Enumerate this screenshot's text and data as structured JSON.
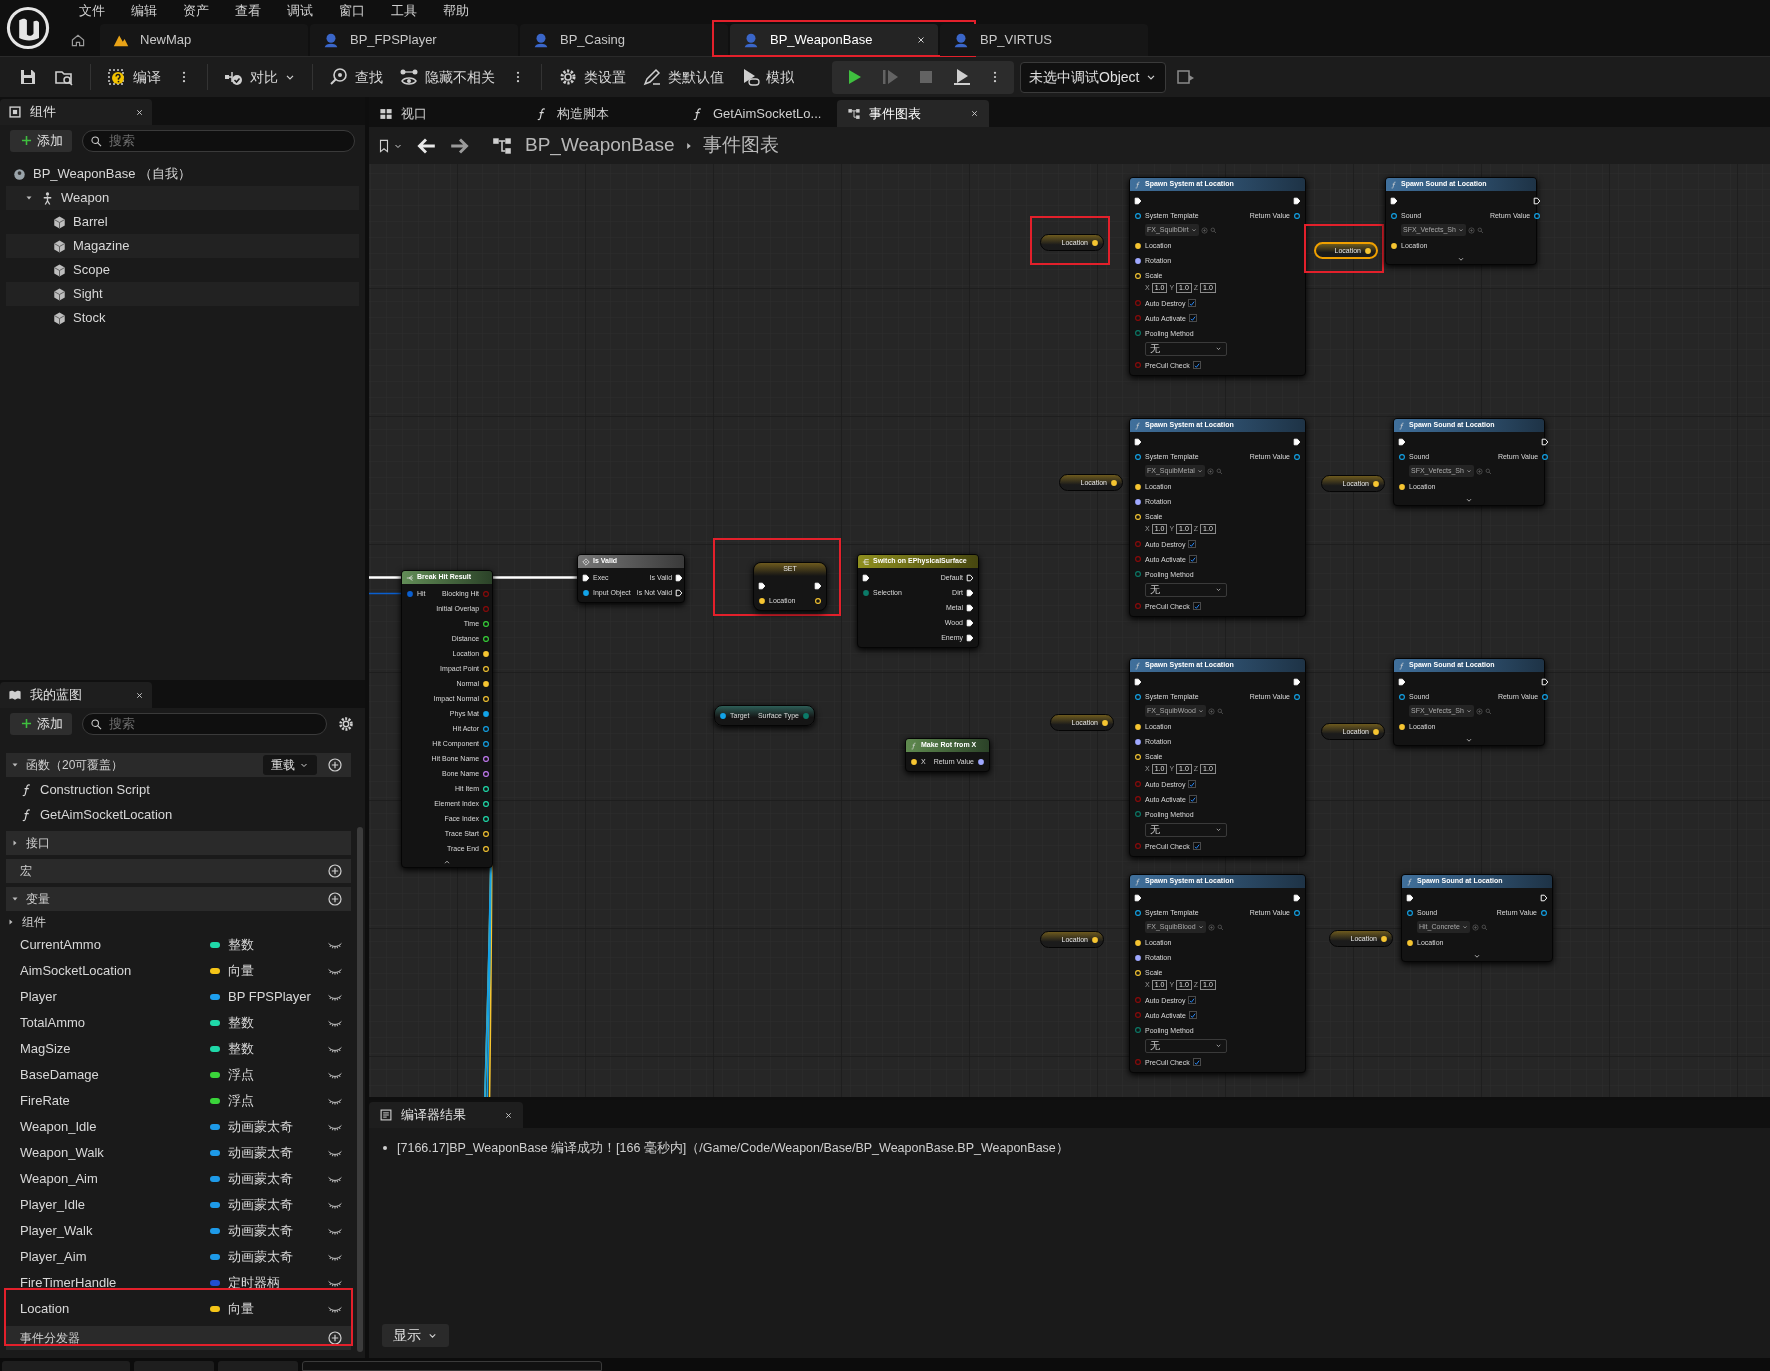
{
  "menu": [
    "文件",
    "编辑",
    "资产",
    "查看",
    "调试",
    "窗口",
    "工具",
    "帮助"
  ],
  "document_tabs": [
    {
      "label": "NewMap",
      "kind": "level",
      "selected": false
    },
    {
      "label": "BP_FPSPlayer",
      "kind": "blueprint",
      "selected": false
    },
    {
      "label": "BP_Casing",
      "kind": "blueprint",
      "selected": false
    },
    {
      "label": "BP_WeaponBase",
      "kind": "blueprint",
      "selected": true,
      "annotated": true
    },
    {
      "label": "BP_VIRTUS",
      "kind": "blueprint",
      "selected": false
    }
  ],
  "toolbar": [
    [
      {
        "kind": "save"
      },
      {
        "kind": "browse"
      }
    ],
    [
      {
        "kind": "compile",
        "label": "编译"
      },
      {
        "kind": "more"
      }
    ],
    [
      {
        "kind": "diff",
        "label": "对比",
        "menu": true
      }
    ],
    [
      {
        "kind": "find",
        "label": "查找"
      },
      {
        "kind": "hide",
        "label": "隐藏不相关"
      },
      {
        "kind": "more"
      }
    ],
    [
      {
        "kind": "settings",
        "label": "类设置"
      },
      {
        "kind": "defaults",
        "label": "类默认值"
      },
      {
        "kind": "simulate",
        "label": "模拟"
      }
    ],
    [
      {
        "kind": "play",
        "disabled": false
      },
      {
        "kind": "step",
        "disabled": true
      },
      {
        "kind": "stop",
        "disabled": true
      },
      {
        "kind": "eject",
        "disabled": false
      },
      {
        "kind": "more",
        "disabled": false
      }
    ],
    [
      {
        "kind": "debug",
        "label": "未选中调试Object",
        "menu": true
      },
      {
        "kind": "debug_browse"
      }
    ]
  ],
  "components_panel": {
    "title": "组件",
    "add_label": "添加",
    "search_placeholder": "搜索",
    "tree": [
      {
        "label": "BP_WeaponBase （自我）",
        "kind": "self",
        "children": [
          {
            "label": "Weapon",
            "kind": "skeletal",
            "expanded": true,
            "children": [
              {
                "label": "Barrel",
                "kind": "mesh"
              },
              {
                "label": "Magazine",
                "kind": "mesh"
              },
              {
                "label": "Scope",
                "kind": "mesh"
              },
              {
                "label": "Sight",
                "kind": "mesh"
              },
              {
                "label": "Stock",
                "kind": "mesh"
              }
            ]
          }
        ]
      }
    ]
  },
  "my_blueprint": {
    "title": "我的蓝图",
    "add_label": "添加",
    "search_placeholder": "搜索",
    "sections": [
      {
        "label": "函数（20可覆盖）",
        "expanded": true,
        "override_label": "重载",
        "addable": true,
        "items": [
          {
            "kind": "function",
            "label": "Construction Script"
          },
          {
            "kind": "function",
            "label": "GetAimSocketLocation"
          }
        ]
      },
      {
        "label": "接口",
        "expanded": false,
        "addable": false
      },
      {
        "label": "宏",
        "addable": true
      },
      {
        "label": "变量",
        "expanded": true,
        "addable": true,
        "items": [
          {
            "kind": "category",
            "label": "组件",
            "expanded": false
          },
          {
            "kind": "variable",
            "label": "CurrentAmmo",
            "type": "整数",
            "color": "#1fd8a8"
          },
          {
            "kind": "variable",
            "label": "AimSocketLocation",
            "type": "向量",
            "color": "#f5c518"
          },
          {
            "kind": "variable",
            "label": "Player",
            "type": "BP FPSPlayer",
            "color": "#1ea0f0"
          },
          {
            "kind": "variable",
            "label": "TotalAmmo",
            "type": "整数",
            "color": "#1fd8a8"
          },
          {
            "kind": "variable",
            "label": "MagSize",
            "type": "整数",
            "color": "#1fd8a8"
          },
          {
            "kind": "variable",
            "label": "BaseDamage",
            "type": "浮点",
            "color": "#3ad43a"
          },
          {
            "kind": "variable",
            "label": "FireRate",
            "type": "浮点",
            "color": "#3ad43a"
          },
          {
            "kind": "variable",
            "label": "Weapon_Idle",
            "type": "动画蒙太奇",
            "color": "#1e9ae8"
          },
          {
            "kind": "variable",
            "label": "Weapon_Walk",
            "type": "动画蒙太奇",
            "color": "#1e9ae8"
          },
          {
            "kind": "variable",
            "label": "Weapon_Aim",
            "type": "动画蒙太奇",
            "color": "#1e9ae8"
          },
          {
            "kind": "variable",
            "label": "Player_Idle",
            "type": "动画蒙太奇",
            "color": "#1e9ae8"
          },
          {
            "kind": "variable",
            "label": "Player_Walk",
            "type": "动画蒙太奇",
            "color": "#1e9ae8"
          },
          {
            "kind": "variable",
            "label": "Player_Aim",
            "type": "动画蒙太奇",
            "color": "#1e9ae8"
          },
          {
            "kind": "variable",
            "label": "FireTimerHandle",
            "type": "定时器柄",
            "color": "#1f4fd0"
          },
          {
            "kind": "variable",
            "label": "Location",
            "type": "向量",
            "color": "#f5c518",
            "annotated": true
          }
        ]
      },
      {
        "label": "事件分发器",
        "addable": true
      }
    ]
  },
  "graph_tabs": [
    {
      "label": "视口",
      "kind": "viewport",
      "selected": false
    },
    {
      "label": "构造脚本",
      "kind": "function",
      "selected": false
    },
    {
      "label": "GetAimSocketLo...",
      "kind": "function",
      "selected": false
    },
    {
      "label": "事件图表",
      "kind": "graph",
      "selected": true
    }
  ],
  "breadcrumb": [
    "BP_WeaponBase",
    "事件图表"
  ],
  "graph": {
    "nodes": [
      {
        "kind": "break",
        "title": "Break Hit Result",
        "selected": false,
        "expanded": true,
        "inputs": [
          {
            "label": "Hit",
            "kind": "hit",
            "connected": true
          }
        ],
        "outputs": [
          {
            "label": "Blocking Hit",
            "kind": "bool",
            "connected": false
          },
          {
            "label": "Initial Overlap",
            "kind": "bool",
            "connected": false
          },
          {
            "label": "Time",
            "kind": "float",
            "connected": false
          },
          {
            "label": "Distance",
            "kind": "float",
            "connected": false
          },
          {
            "label": "Location",
            "kind": "vector",
            "connected": true
          },
          {
            "label": "Impact Point",
            "kind": "vector",
            "connected": false
          },
          {
            "label": "Normal",
            "kind": "vector",
            "connected": true
          },
          {
            "label": "Impact Normal",
            "kind": "vector",
            "connected": false
          },
          {
            "label": "Phys Mat",
            "kind": "object",
            "connected": true
          },
          {
            "label": "Hit Actor",
            "kind": "object",
            "connected": false
          },
          {
            "label": "Hit Component",
            "kind": "object",
            "connected": false
          },
          {
            "label": "Hit Bone Name",
            "kind": "name",
            "connected": false
          },
          {
            "label": "Bone Name",
            "kind": "name",
            "connected": false
          },
          {
            "label": "Hit Item",
            "kind": "int",
            "connected": false
          },
          {
            "label": "Element Index",
            "kind": "int",
            "connected": false
          },
          {
            "label": "Face Index",
            "kind": "int",
            "connected": false
          },
          {
            "label": "Trace Start",
            "kind": "vector",
            "connected": false
          },
          {
            "label": "Trace End",
            "kind": "vector",
            "connected": false
          }
        ]
      },
      {
        "kind": "macro",
        "title": "Is Valid",
        "selected": false,
        "inputs": [
          {
            "label": "Exec",
            "kind": "exec",
            "connected": true
          },
          {
            "label": "Input Object",
            "kind": "object",
            "connected": true
          }
        ],
        "outputs": [
          {
            "label": "Is Valid",
            "kind": "exec",
            "connected": true
          },
          {
            "label": "Is Not Valid",
            "kind": "exec",
            "connected": false
          }
        ]
      },
      {
        "kind": "set",
        "title": "SET",
        "selected": false,
        "annotated": true,
        "inputs": [
          {
            "kind": "exec",
            "connected": true
          },
          {
            "label": "Location",
            "kind": "vector",
            "connected": true
          }
        ],
        "outputs": [
          {
            "kind": "exec",
            "connected": true
          },
          {
            "kind": "vector",
            "connected": false
          }
        ]
      },
      {
        "kind": "pure",
        "selected": false,
        "inputs": [
          {
            "label": "Target",
            "kind": "object",
            "connected": true
          }
        ],
        "outputs": [
          {
            "label": "Surface Type",
            "kind": "byte",
            "connected": true
          }
        ]
      },
      {
        "kind": "switch",
        "title": "Switch on EPhysicalSurface",
        "selected": false,
        "inputs": [
          {
            "kind": "exec",
            "connected": true
          },
          {
            "label": "Selection",
            "kind": "byte",
            "connected": true
          }
        ],
        "outputs": [
          {
            "label": "Default",
            "kind": "exec",
            "connected": false
          },
          {
            "label": "Dirt",
            "kind": "exec",
            "connected": true
          },
          {
            "label": "Metal",
            "kind": "exec",
            "connected": true
          },
          {
            "label": "Wood",
            "kind": "exec",
            "connected": true
          },
          {
            "label": "Enemy",
            "kind": "exec",
            "connected": true
          }
        ]
      },
      {
        "kind": "pure_function",
        "title": "Make Rot from X",
        "selected": false,
        "inputs": [
          {
            "label": "X",
            "kind": "vector",
            "connected": true
          }
        ],
        "outputs": [
          {
            "label": "Return Value",
            "kind": "rotator",
            "connected": true
          }
        ]
      },
      {
        "kind": "variable",
        "selected": false,
        "annotated": true,
        "outputs": [
          {
            "label": "Location",
            "kind": "vector",
            "connected": true
          }
        ]
      },
      {
        "kind": "function",
        "title": "Spawn System at Location",
        "selected": false,
        "inputs": [
          {
            "kind": "exec",
            "connected": true
          },
          {
            "label": "System Template",
            "kind": "object",
            "connected": false,
            "value": "FX_SquibDirt"
          },
          {
            "label": "Location",
            "kind": "vector",
            "connected": true
          },
          {
            "label": "Rotation",
            "kind": "rotator",
            "connected": true
          },
          {
            "label": "Scale",
            "kind": "vector",
            "connected": false,
            "xyz": [
              {
                "axis": "X",
                "value": "1.0"
              },
              {
                "axis": "Y",
                "value": "1.0"
              },
              {
                "axis": "Z",
                "value": "1.0"
              }
            ]
          },
          {
            "label": "Auto Destroy",
            "kind": "bool",
            "connected": false,
            "checked": true
          },
          {
            "label": "Auto Activate",
            "kind": "bool",
            "connected": false,
            "checked": true
          },
          {
            "label": "Pooling Method",
            "kind": "byte",
            "connected": false,
            "value": "无"
          },
          {
            "label": "PreCull Check",
            "kind": "bool",
            "connected": false,
            "checked": true
          }
        ],
        "outputs": [
          {
            "kind": "exec",
            "connected": true
          },
          {
            "label": "Return Value",
            "kind": "object",
            "connected": false
          }
        ]
      },
      {
        "kind": "variable",
        "selected": true,
        "annotated": true,
        "outputs": [
          {
            "label": "Location",
            "kind": "vector",
            "connected": true
          }
        ]
      },
      {
        "kind": "function",
        "title": "Spawn Sound at Location",
        "selected": false,
        "expanded": false,
        "inputs": [
          {
            "kind": "exec",
            "connected": true
          },
          {
            "label": "Sound",
            "kind": "object",
            "connected": false,
            "value": "SFX_Vefects_Sh"
          },
          {
            "label": "Location",
            "kind": "vector",
            "connected": true
          }
        ],
        "outputs": [
          {
            "kind": "exec",
            "connected": false
          },
          {
            "label": "Return Value",
            "kind": "object",
            "connected": false
          }
        ]
      },
      {
        "kind": "variable",
        "selected": false,
        "outputs": [
          {
            "label": "Location",
            "kind": "vector",
            "connected": true
          }
        ]
      },
      {
        "kind": "function",
        "title": "Spawn System at Location",
        "selected": false,
        "inputs": [
          {
            "kind": "exec",
            "connected": true
          },
          {
            "label": "System Template",
            "kind": "object",
            "connected": false,
            "value": "FX_SquibMetal"
          },
          {
            "label": "Location",
            "kind": "vector",
            "connected": true
          },
          {
            "label": "Rotation",
            "kind": "rotator",
            "connected": true
          },
          {
            "label": "Scale",
            "kind": "vector",
            "connected": false,
            "xyz": [
              {
                "axis": "X",
                "value": "1.0"
              },
              {
                "axis": "Y",
                "value": "1.0"
              },
              {
                "axis": "Z",
                "value": "1.0"
              }
            ]
          },
          {
            "label": "Auto Destroy",
            "kind": "bool",
            "connected": false,
            "checked": true
          },
          {
            "label": "Auto Activate",
            "kind": "bool",
            "connected": false,
            "checked": true
          },
          {
            "label": "Pooling Method",
            "kind": "byte",
            "connected": false,
            "value": "无"
          },
          {
            "label": "PreCull Check",
            "kind": "bool",
            "connected": false,
            "checked": true
          }
        ],
        "outputs": [
          {
            "kind": "exec",
            "connected": true
          },
          {
            "label": "Return Value",
            "kind": "object",
            "connected": false
          }
        ]
      },
      {
        "kind": "variable",
        "selected": false,
        "outputs": [
          {
            "label": "Location",
            "kind": "vector",
            "connected": true
          }
        ]
      },
      {
        "kind": "function",
        "title": "Spawn Sound at Location",
        "selected": false,
        "expanded": false,
        "inputs": [
          {
            "kind": "exec",
            "connected": true
          },
          {
            "label": "Sound",
            "kind": "object",
            "connected": false,
            "value": "SFX_Vefects_Sh"
          },
          {
            "label": "Location",
            "kind": "vector",
            "connected": true
          }
        ],
        "outputs": [
          {
            "kind": "exec",
            "connected": false
          },
          {
            "label": "Return Value",
            "kind": "object",
            "connected": false
          }
        ]
      },
      {
        "kind": "variable",
        "selected": false,
        "outputs": [
          {
            "label": "Location",
            "kind": "vector",
            "connected": true
          }
        ]
      },
      {
        "kind": "function",
        "title": "Spawn System at Location",
        "selected": false,
        "inputs": [
          {
            "kind": "exec",
            "connected": true
          },
          {
            "label": "System Template",
            "kind": "object",
            "connected": false,
            "value": "FX_SquibWood"
          },
          {
            "label": "Location",
            "kind": "vector",
            "connected": true
          },
          {
            "label": "Rotation",
            "kind": "rotator",
            "connected": true
          },
          {
            "label": "Scale",
            "kind": "vector",
            "connected": false,
            "xyz": [
              {
                "axis": "X",
                "value": "1.0"
              },
              {
                "axis": "Y",
                "value": "1.0"
              },
              {
                "axis": "Z",
                "value": "1.0"
              }
            ]
          },
          {
            "label": "Auto Destroy",
            "kind": "bool",
            "connected": false,
            "checked": true
          },
          {
            "label": "Auto Activate",
            "kind": "bool",
            "connected": false,
            "checked": true
          },
          {
            "label": "Pooling Method",
            "kind": "byte",
            "connected": false,
            "value": "无"
          },
          {
            "label": "PreCull Check",
            "kind": "bool",
            "connected": false,
            "checked": true
          }
        ],
        "outputs": [
          {
            "kind": "exec",
            "connected": true
          },
          {
            "label": "Return Value",
            "kind": "object",
            "connected": false
          }
        ]
      },
      {
        "kind": "variable",
        "selected": false,
        "outputs": [
          {
            "label": "Location",
            "kind": "vector",
            "connected": true
          }
        ]
      },
      {
        "kind": "function",
        "title": "Spawn Sound at Location",
        "selected": false,
        "expanded": false,
        "inputs": [
          {
            "kind": "exec",
            "connected": true
          },
          {
            "label": "Sound",
            "kind": "object",
            "connected": false,
            "value": "SFX_Vefects_Sh"
          },
          {
            "label": "Location",
            "kind": "vector",
            "connected": true
          }
        ],
        "outputs": [
          {
            "kind": "exec",
            "connected": false
          },
          {
            "label": "Return Value",
            "kind": "object",
            "connected": false
          }
        ]
      },
      {
        "kind": "variable",
        "selected": false,
        "outputs": [
          {
            "label": "Location",
            "kind": "vector",
            "connected": true
          }
        ]
      },
      {
        "kind": "function",
        "title": "Spawn System at Location",
        "selected": false,
        "inputs": [
          {
            "kind": "exec",
            "connected": true
          },
          {
            "label": "System Template",
            "kind": "object",
            "connected": false,
            "value": "FX_SquibBlood"
          },
          {
            "label": "Location",
            "kind": "vector",
            "connected": true
          },
          {
            "label": "Rotation",
            "kind": "rotator",
            "connected": true
          },
          {
            "label": "Scale",
            "kind": "vector",
            "connected": false,
            "xyz": [
              {
                "axis": "X",
                "value": "1.0"
              },
              {
                "axis": "Y",
                "value": "1.0"
              },
              {
                "axis": "Z",
                "value": "1.0"
              }
            ]
          },
          {
            "label": "Auto Destroy",
            "kind": "bool",
            "connected": false,
            "checked": true
          },
          {
            "label": "Auto Activate",
            "kind": "bool",
            "connected": false,
            "checked": true
          },
          {
            "label": "Pooling Method",
            "kind": "byte",
            "connected": false,
            "value": "无"
          },
          {
            "label": "PreCull Check",
            "kind": "bool",
            "connected": false,
            "checked": true
          }
        ],
        "outputs": [
          {
            "kind": "exec",
            "connected": true
          },
          {
            "label": "Return Value",
            "kind": "object",
            "connected": false
          }
        ]
      },
      {
        "kind": "variable",
        "selected": false,
        "outputs": [
          {
            "label": "Location",
            "kind": "vector",
            "connected": true
          }
        ]
      },
      {
        "kind": "function",
        "title": "Spawn Sound at Location",
        "selected": false,
        "expanded": false,
        "inputs": [
          {
            "kind": "exec",
            "connected": true
          },
          {
            "label": "Sound",
            "kind": "object",
            "connected": false,
            "value": "Hit_Concrete"
          },
          {
            "label": "Location",
            "kind": "vector",
            "connected": true
          }
        ],
        "outputs": [
          {
            "kind": "exec",
            "connected": false
          },
          {
            "label": "Return Value",
            "kind": "object",
            "connected": false
          }
        ]
      }
    ]
  },
  "compiler_results": {
    "title": "编译器结果",
    "messages": [
      "[7166.17]BP_WeaponBase 编译成功！[166 毫秒内]（/Game/Code/Weapon/Base/BP_WeaponBase.BP_WeaponBase）"
    ],
    "show_label": "显示"
  }
}
